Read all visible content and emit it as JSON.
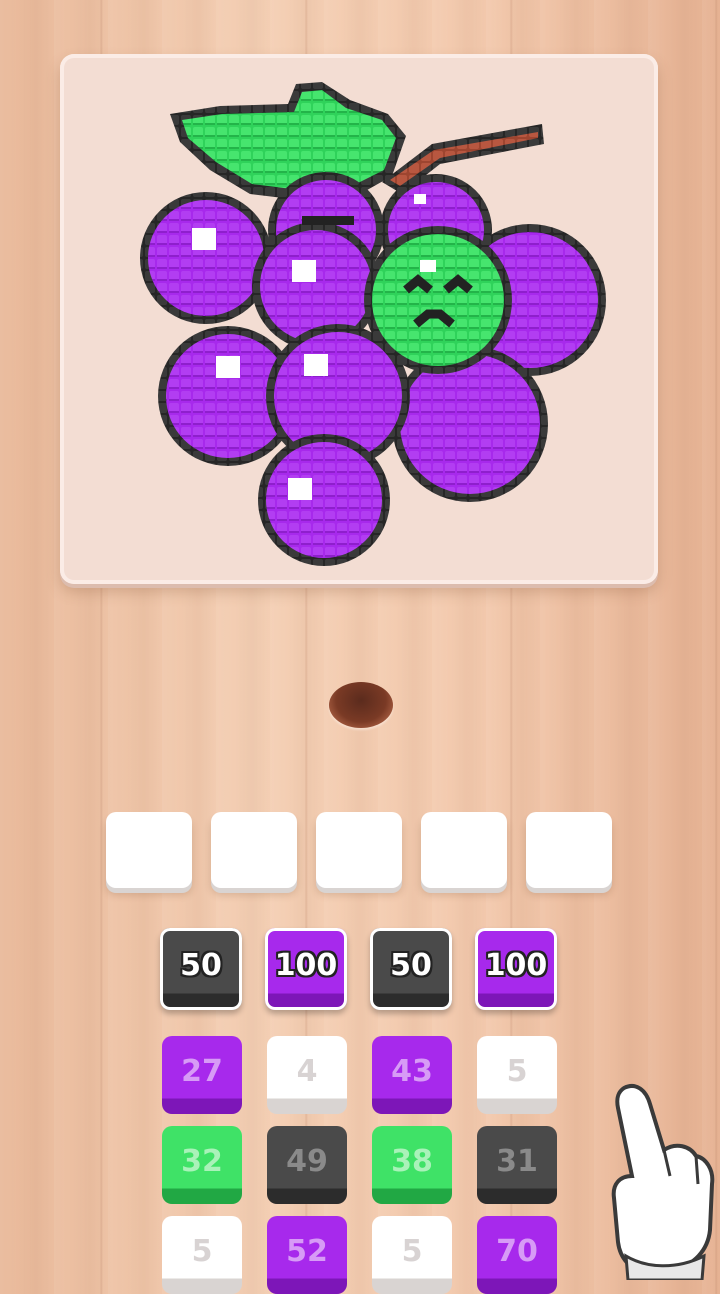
{
  "picture": {
    "subject": "grapes",
    "palette": {
      "purple": "#a729ec",
      "green": "#3fe267",
      "dark": "#333333",
      "stem": "#b2513a",
      "white": "#ffffff"
    }
  },
  "slots": {
    "count": 5,
    "filled": 0
  },
  "tiles": [
    {
      "label": "50",
      "color": "dark",
      "state": "front"
    },
    {
      "label": "100",
      "color": "purple",
      "state": "front"
    },
    {
      "label": "50",
      "color": "dark",
      "state": "front"
    },
    {
      "label": "100",
      "color": "purple",
      "state": "front"
    },
    {
      "label": "27",
      "color": "purple",
      "state": "back"
    },
    {
      "label": "4",
      "color": "white",
      "state": "back"
    },
    {
      "label": "43",
      "color": "purple",
      "state": "back"
    },
    {
      "label": "5",
      "color": "white",
      "state": "back"
    },
    {
      "label": "32",
      "color": "green",
      "state": "back"
    },
    {
      "label": "49",
      "color": "dark",
      "state": "back"
    },
    {
      "label": "38",
      "color": "green",
      "state": "back"
    },
    {
      "label": "31",
      "color": "dark",
      "state": "back"
    },
    {
      "label": "5",
      "color": "white",
      "state": "back"
    },
    {
      "label": "52",
      "color": "purple",
      "state": "back"
    },
    {
      "label": "5",
      "color": "white",
      "state": "back"
    },
    {
      "label": "70",
      "color": "purple",
      "state": "back"
    }
  ],
  "icons": {
    "hand": "pointing-hand-icon",
    "hole": "drop-hole-icon"
  }
}
